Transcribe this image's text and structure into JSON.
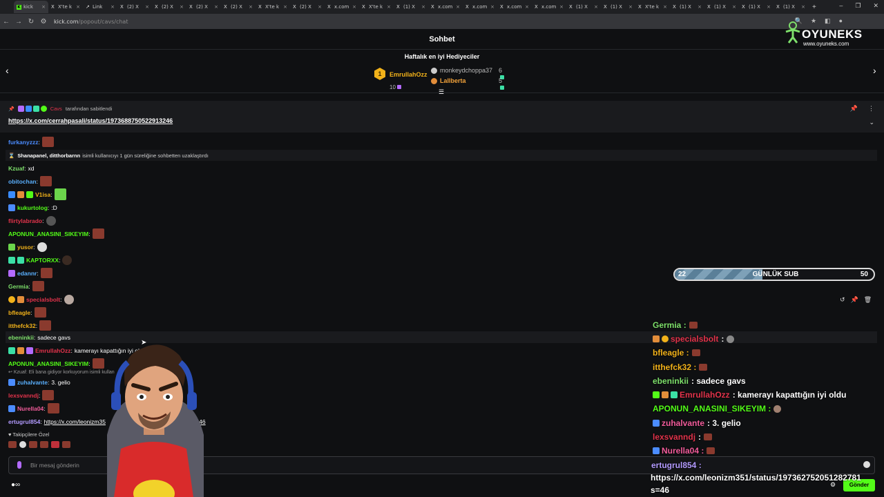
{
  "browser": {
    "tabs": [
      "kick",
      "X'te k",
      "Link",
      "(2) X",
      "(2) X",
      "(2) X",
      "(2) X",
      "X'te k",
      "(2) X",
      "x.com",
      "X'te k",
      "(1) X",
      "x.com",
      "x.com",
      "x.com",
      "x.com",
      "(1) X",
      "(1) X",
      "X'te k",
      "(1) X",
      "(1) X",
      "(1) X",
      "(1) X"
    ],
    "url_host": "kick.com",
    "url_path": "/popout/cavs/chat"
  },
  "header": {
    "title": "Sohbet"
  },
  "logo": {
    "brand": "OYUNEKS",
    "site": "www.oyuneks.com"
  },
  "gifters": {
    "heading": "Haftalık en iyi Hediyeciler",
    "first": {
      "rank": "1",
      "name": "EmrullahOzz",
      "count": "10"
    },
    "second": {
      "name": "monkeydchoppa37",
      "count": "6"
    },
    "third": {
      "name": "Lallberta",
      "count": "5"
    }
  },
  "pinned": {
    "user": "Cavs",
    "suffix": "tarafından sabitlendi",
    "link": "https://x.com/cerrahpasali/status/1973688750522913246"
  },
  "chat": {
    "furkan": "furkanyzzz",
    "sys_users": "Shanapanel, ditthorbarnn",
    "sys_text": "isimli kullanıcıyı 1 gün süreliğine sohbetten uzaklaştırdı",
    "kzuaf": "Kzuaf",
    "kzuaf_msg": "xd",
    "obito": "obitochan",
    "vlisa": "V1isa",
    "kukurt": "kukurtolog",
    "kukurt_msg": ":D",
    "flirty": "flirtylabrado",
    "aponun": "APONUN_ANASINI_SIKEYIM",
    "yusor": "yusor",
    "kaptor": "KAPTORXX",
    "edannr": "edannr",
    "germia": "Germia",
    "special": "specialsbolt",
    "bfleagle": "bfleagle",
    "itthefck": "itthefck32",
    "ebeninkii": "ebeninkii",
    "ebeninkii_msg": "sadece gavs",
    "emrullah": "EmrullahOzz",
    "emrullah_msg": "kamerayı kapattığın iyi oldu",
    "aponun2": "APONUN_ANASINI_SIKEYIM",
    "reply": "Kzuaf: Eli bana gidiyor korkuyorum isimli kullan",
    "zuhal": "zuhalvante",
    "zuhal_msg": "3. gelio",
    "lexs": "lexsvanndj",
    "nurella": "Nurella04",
    "ertugrul": "ertugrul854",
    "ertugrul_msg": "https://x.com/leonizm35",
    "ertugrul_tail": "s=46"
  },
  "followers": {
    "label": "Takipçilere Özel"
  },
  "input": {
    "placeholder": "Bir mesaj gönderin"
  },
  "send": {
    "label": "Gönder"
  },
  "sub_goal": {
    "current": "22",
    "label": "GÜNLÜK SUB",
    "target": "50",
    "progress": 0.44
  },
  "overlay": {
    "l1": "Germia :",
    "l2": "specialsbolt",
    "l3": "bfleagle :",
    "l4": "itthefck32 :",
    "l5u": "ebeninkii",
    "l5m": ": sadece gavs",
    "l6u": "EmrullahOzz",
    "l6m": ": kamerayı kapattığın iyi oldu",
    "l7": "APONUN_ANASINI_SIKEYIM :",
    "l8u": "zuhalvante",
    "l8m": ": 3. gelio",
    "l9": "lexsvanndj",
    "l10": "Nurella04 :",
    "l11": "ertugrul854 :",
    "l12": "https://x.com/leonizm351/status/197362752051282781",
    "l13": "s=46"
  },
  "colors": {
    "kick_green": "#53fc18",
    "gold": "#f2b21a",
    "red_user": "#e2334b",
    "blue_user": "#4b8cff"
  }
}
